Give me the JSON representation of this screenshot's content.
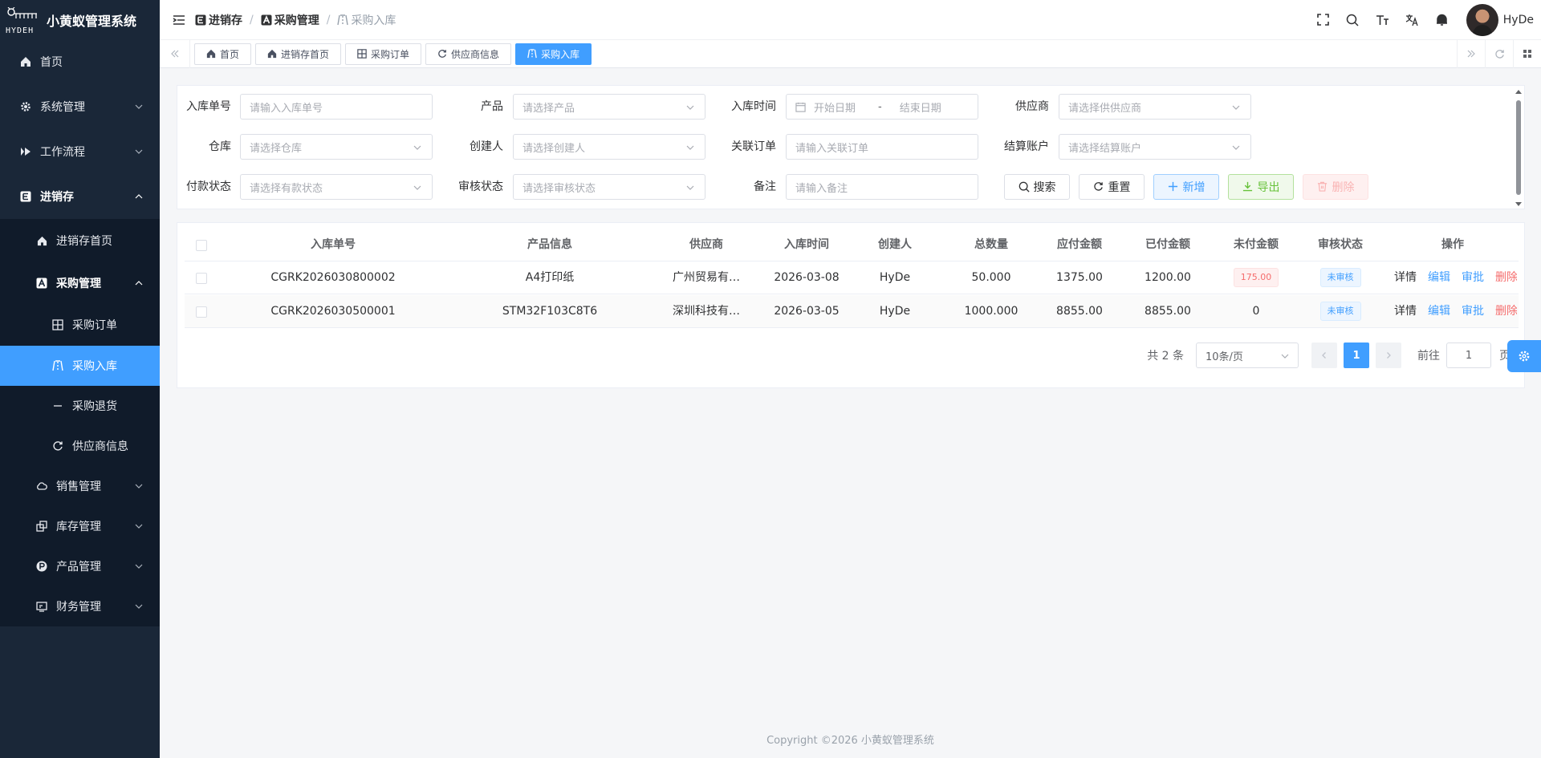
{
  "app": {
    "title": "小黄蚁管理系统",
    "brand": "HYDEH"
  },
  "sidebar": {
    "items": [
      {
        "label": "首页",
        "icon": "home-icon"
      },
      {
        "label": "系统管理",
        "icon": "gear-icon"
      },
      {
        "label": "工作流程",
        "icon": "workflow-icon"
      },
      {
        "label": "进销存",
        "icon": "inventory-e-icon"
      },
      {
        "label": "进销存首页",
        "icon": "home-icon"
      },
      {
        "label": "采购管理",
        "icon": "purchase-a-icon"
      },
      {
        "label": "采购订单",
        "icon": "grid-icon"
      },
      {
        "label": "采购入库",
        "icon": "road-icon"
      },
      {
        "label": "采购退货",
        "icon": "dash-icon"
      },
      {
        "label": "供应商信息",
        "icon": "refresh-icon"
      },
      {
        "label": "销售管理",
        "icon": "cloud-icon"
      },
      {
        "label": "库存管理",
        "icon": "copy-icon"
      },
      {
        "label": "产品管理",
        "icon": "p-circle-icon"
      },
      {
        "label": "财务管理",
        "icon": "finance-icon"
      }
    ]
  },
  "header": {
    "breadcrumb": [
      "进销存",
      "采购管理",
      "采购入库"
    ],
    "user": "HyDe"
  },
  "tabs": [
    "首页",
    "进销存首页",
    "采购订单",
    "供应商信息",
    "采购入库"
  ],
  "filter": {
    "labels": {
      "order_no": "入库单号",
      "product": "产品",
      "in_time": "入库时间",
      "supplier": "供应商",
      "warehouse": "仓库",
      "creator": "创建人",
      "related_order": "关联订单",
      "account": "结算账户",
      "pay_status": "付款状态",
      "audit_status": "审核状态",
      "remark": "备注"
    },
    "placeholders": {
      "order_no": "请输入入库单号",
      "product": "请选择产品",
      "start_date": "开始日期",
      "end_date": "结束日期",
      "supplier": "请选择供供应商",
      "warehouse": "请选择仓库",
      "creator": "请选择创建人",
      "related_order": "请输入关联订单",
      "account": "请选择结算账户",
      "pay_status": "请选择有款状态",
      "audit_status": "请选择审核状态",
      "remark": "请输入备注"
    },
    "range_sep": "-",
    "buttons": {
      "search": "搜索",
      "reset": "重置",
      "add": "新增",
      "export": "导出",
      "delete": "删除"
    }
  },
  "table": {
    "columns": [
      "入库单号",
      "产品信息",
      "供应商",
      "入库时间",
      "创建人",
      "总数量",
      "应付金额",
      "已付金额",
      "未付金额",
      "审核状态",
      "操作"
    ],
    "rows": [
      {
        "order_no": "CGRK2026030800002",
        "product": "A4打印纸",
        "supplier": "广州贸易有…",
        "time": "2026-03-08",
        "creator": "HyDe",
        "qty": "50.000",
        "payable": "1375.00",
        "paid": "1200.00",
        "unpaid": "175.00",
        "status": "未审核"
      },
      {
        "order_no": "CGRK2026030500001",
        "product": "STM32F103C8T6",
        "supplier": "深圳科技有…",
        "time": "2026-03-05",
        "creator": "HyDe",
        "qty": "1000.000",
        "payable": "8855.00",
        "paid": "8855.00",
        "unpaid": "0",
        "status": "未审核"
      }
    ],
    "ops": {
      "detail": "详情",
      "edit": "编辑",
      "approve": "审批",
      "delete": "删除"
    }
  },
  "pagination": {
    "total": "共 2 条",
    "size": "10条/页",
    "current": "1",
    "goto": "前往",
    "jump": "1",
    "page": "页"
  },
  "footer": "Copyright ©2026 小黄蚁管理系统",
  "colors": {
    "primary": "#409eff",
    "sidebar": "#1a2738",
    "danger": "#f56c6c",
    "success": "#67c23a"
  }
}
